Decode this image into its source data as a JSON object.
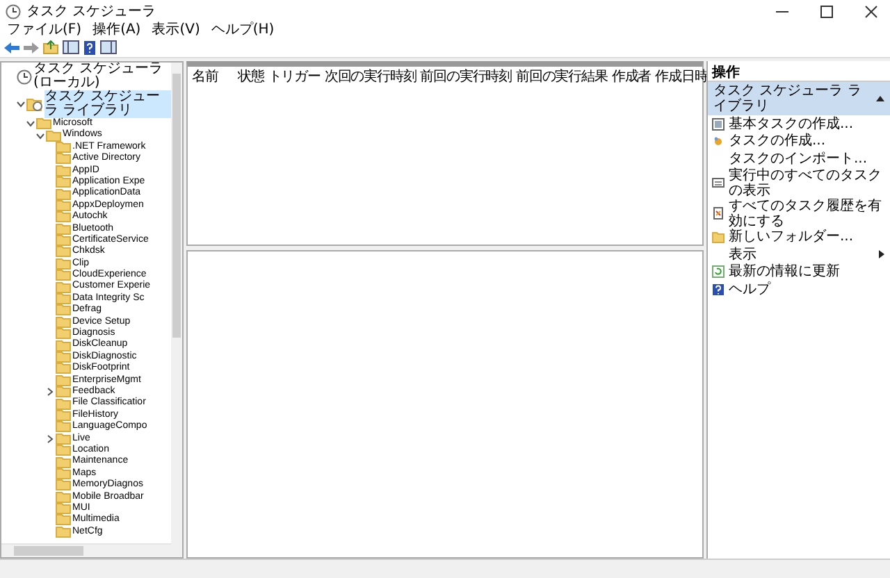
{
  "window": {
    "title": "タスク スケジューラ"
  },
  "menu": [
    "ファイル(F)",
    "操作(A)",
    "表示(V)",
    "ヘルプ(H)"
  ],
  "tree": {
    "items": [
      {
        "label": "タスク スケジューラ (ローカル)",
        "kind": "root",
        "selected": false,
        "children": [
          {
            "label": "タスク スケジューラ ライブラリ",
            "kind": "library",
            "selected": true,
            "expanded": true,
            "children": [
              {
                "label": "Microsoft",
                "kind": "folder",
                "selected": false,
                "expanded": true,
                "children": [
                  {
                    "label": "Windows",
                    "kind": "folder",
                    "selected": false,
                    "expanded": true,
                    "children": [
                      {
                        "label": ".NET Framework",
                        "kind": "folder",
                        "selected": false
                      },
                      {
                        "label": "Active Directory",
                        "kind": "folder",
                        "selected": false
                      },
                      {
                        "label": "AppID",
                        "kind": "folder",
                        "selected": false
                      },
                      {
                        "label": "Application Expe",
                        "kind": "folder",
                        "selected": false
                      },
                      {
                        "label": "ApplicationData",
                        "kind": "folder",
                        "selected": false
                      },
                      {
                        "label": "AppxDeploymen",
                        "kind": "folder",
                        "selected": false
                      },
                      {
                        "label": "Autochk",
                        "kind": "folder",
                        "selected": false
                      },
                      {
                        "label": "Bluetooth",
                        "kind": "folder",
                        "selected": false
                      },
                      {
                        "label": "CertificateService",
                        "kind": "folder",
                        "selected": false
                      },
                      {
                        "label": "Chkdsk",
                        "kind": "folder",
                        "selected": false
                      },
                      {
                        "label": "Clip",
                        "kind": "folder",
                        "selected": false
                      },
                      {
                        "label": "CloudExperience",
                        "kind": "folder",
                        "selected": false
                      },
                      {
                        "label": "Customer Experie",
                        "kind": "folder",
                        "selected": false
                      },
                      {
                        "label": "Data Integrity Sc",
                        "kind": "folder",
                        "selected": false
                      },
                      {
                        "label": "Defrag",
                        "kind": "folder",
                        "selected": false
                      },
                      {
                        "label": "Device Setup",
                        "kind": "folder",
                        "selected": false
                      },
                      {
                        "label": "Diagnosis",
                        "kind": "folder",
                        "selected": false
                      },
                      {
                        "label": "DiskCleanup",
                        "kind": "folder",
                        "selected": false
                      },
                      {
                        "label": "DiskDiagnostic",
                        "kind": "folder",
                        "selected": false
                      },
                      {
                        "label": "DiskFootprint",
                        "kind": "folder",
                        "selected": false
                      },
                      {
                        "label": "EnterpriseMgmt",
                        "kind": "folder",
                        "selected": false
                      },
                      {
                        "label": "Feedback",
                        "kind": "folder",
                        "selected": false,
                        "expanded": false
                      },
                      {
                        "label": "File Classificatior",
                        "kind": "folder",
                        "selected": false
                      },
                      {
                        "label": "FileHistory",
                        "kind": "folder",
                        "selected": false
                      },
                      {
                        "label": "LanguageCompo",
                        "kind": "folder",
                        "selected": false
                      },
                      {
                        "label": "Live",
                        "kind": "folder",
                        "selected": false,
                        "expanded": false
                      },
                      {
                        "label": "Location",
                        "kind": "folder",
                        "selected": false
                      },
                      {
                        "label": "Maintenance",
                        "kind": "folder",
                        "selected": false
                      },
                      {
                        "label": "Maps",
                        "kind": "folder",
                        "selected": false
                      },
                      {
                        "label": "MemoryDiagnos",
                        "kind": "folder",
                        "selected": false
                      },
                      {
                        "label": "Mobile Broadbar",
                        "kind": "folder",
                        "selected": false
                      },
                      {
                        "label": "MUI",
                        "kind": "folder",
                        "selected": false
                      },
                      {
                        "label": "Multimedia",
                        "kind": "folder",
                        "selected": false
                      },
                      {
                        "label": "NetCfg",
                        "kind": "folder",
                        "selected": false
                      }
                    ]
                  }
                ]
              }
            ]
          }
        ]
      }
    ]
  },
  "table": {
    "columns": [
      "名前",
      "状態",
      "トリガー",
      "次回の実行時刻",
      "前回の実行時刻",
      "前回の実行結果",
      "作成者",
      "作成日時"
    ]
  },
  "actions": {
    "title": "操作",
    "section": "タスク スケジューラ ライブラリ",
    "items": [
      {
        "label": "基本タスクの作成...",
        "kind": "basic-task",
        "submenu": false
      },
      {
        "label": "タスクの作成...",
        "kind": "create-task",
        "submenu": false
      },
      {
        "label": "タスクのインポート...",
        "kind": "plain",
        "submenu": false
      },
      {
        "label": "実行中のすべてのタスクの表示",
        "kind": "running",
        "submenu": false
      },
      {
        "label": "すべてのタスク履歴を有効にする",
        "kind": "history",
        "submenu": false
      },
      {
        "label": "新しいフォルダー...",
        "kind": "folder",
        "submenu": false
      },
      {
        "label": "表示",
        "kind": "plain",
        "submenu": true
      },
      {
        "label": "最新の情報に更新",
        "kind": "refresh",
        "submenu": false
      },
      {
        "label": "ヘルプ",
        "kind": "help",
        "submenu": false
      }
    ]
  }
}
